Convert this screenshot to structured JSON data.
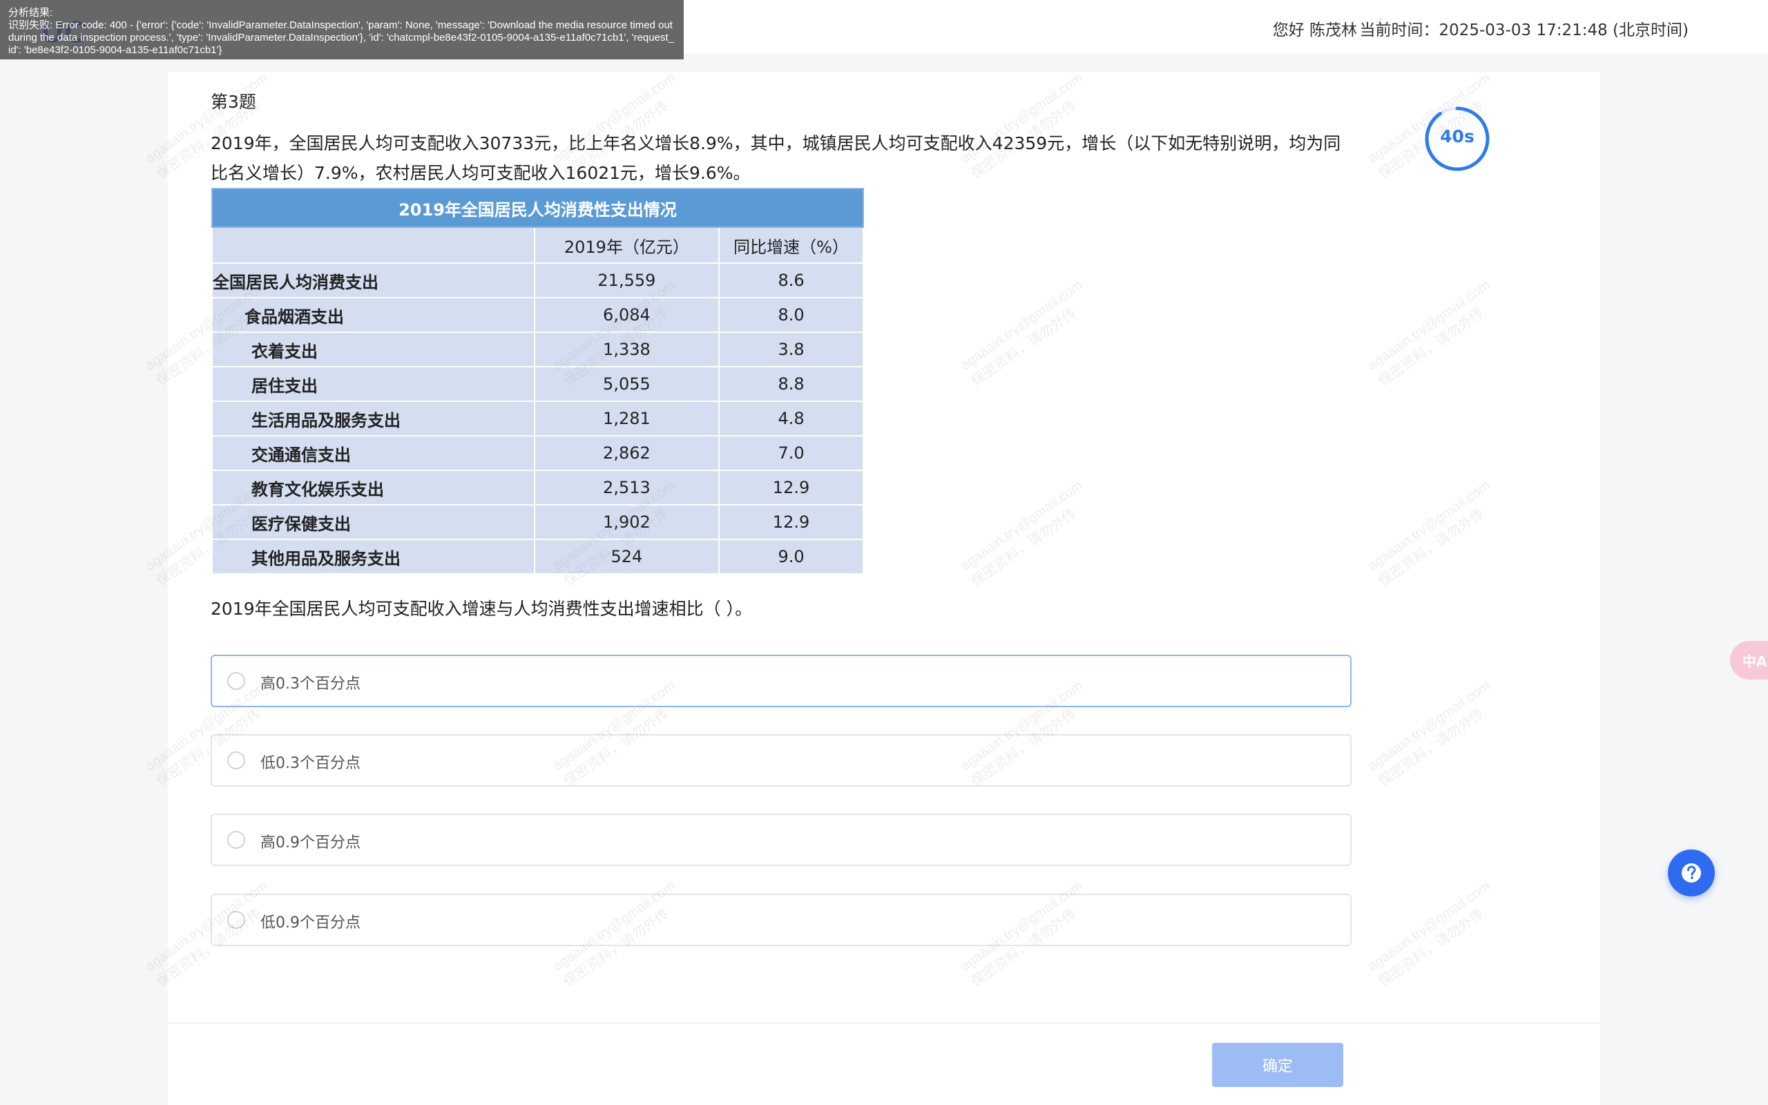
{
  "header": {
    "logo_text": "UC",
    "greeting": "您好 陈茂林",
    "clock": "当前时间：2025-03-03 17:21:48 (北京时间)"
  },
  "error_overlay": {
    "title": "分析结果:",
    "message": "识别失败: Error code: 400 - {'error': {'code': 'InvalidParameter.DataInspection', 'param': None, 'message': 'Download the media resource timed out during the data inspection process.', 'type': 'InvalidParameter.DataInspection'}, 'id': 'chatcmpl-be8e43f2-0105-9004-a135-e11af0c71cb1', 'request_id': 'be8e43f2-0105-9004-a135-e11af0c71cb1'}"
  },
  "question": {
    "number": "第3题",
    "stem": "2019年，全国居民人均可支配收入30733元，比上年名义增长8.9%，其中，城镇居民人均可支配收入42359元，增长（以下如无特别说明，均为同比名义增长）7.9%，农村居民人均可支配收入16021元，增长9.6%。",
    "prompt": "2019年全国居民人均可支配收入增速与人均消费性支出增速相比（ ）。"
  },
  "table": {
    "caption": "2019年全国居民人均消费性支出情况",
    "columns": [
      "",
      "2019年（亿元）",
      "同比增速（%）"
    ],
    "rows": [
      {
        "name": "全国居民人均消费支出",
        "value": "21,559",
        "growth": "8.6"
      },
      {
        "name": "食品烟酒支出",
        "value": "6,084",
        "growth": "8.0"
      },
      {
        "name": "衣着支出",
        "value": "1,338",
        "growth": "3.8"
      },
      {
        "name": "居住支出",
        "value": "5,055",
        "growth": "8.8"
      },
      {
        "name": "生活用品及服务支出",
        "value": "1,281",
        "growth": "4.8"
      },
      {
        "name": "交通通信支出",
        "value": "2,862",
        "growth": "7.0"
      },
      {
        "name": "教育文化娱乐支出",
        "value": "2,513",
        "growth": "12.9"
      },
      {
        "name": "医疗保健支出",
        "value": "1,902",
        "growth": "12.9"
      },
      {
        "name": "其他用品及服务支出",
        "value": "524",
        "growth": "9.0"
      }
    ]
  },
  "options": [
    {
      "label": "高0.3个百分点"
    },
    {
      "label": "低0.3个百分点"
    },
    {
      "label": "高0.9个百分点"
    },
    {
      "label": "低0.9个百分点"
    }
  ],
  "timer": {
    "text": "40s"
  },
  "submit": {
    "label": "确定"
  },
  "translate_widget": {
    "text": "中A"
  },
  "help_widget": {
    "icon": "question-icon"
  },
  "watermark": {
    "line1": "agaaain.try@gmail.com",
    "line2": "保密资料，请勿外传"
  },
  "colors": {
    "accent": "#2f7bea",
    "table_header": "#5b9bd5",
    "table_cell": "#d4def0",
    "submit_disabled": "#9dbcf6",
    "help_button": "#2f6bf0"
  }
}
